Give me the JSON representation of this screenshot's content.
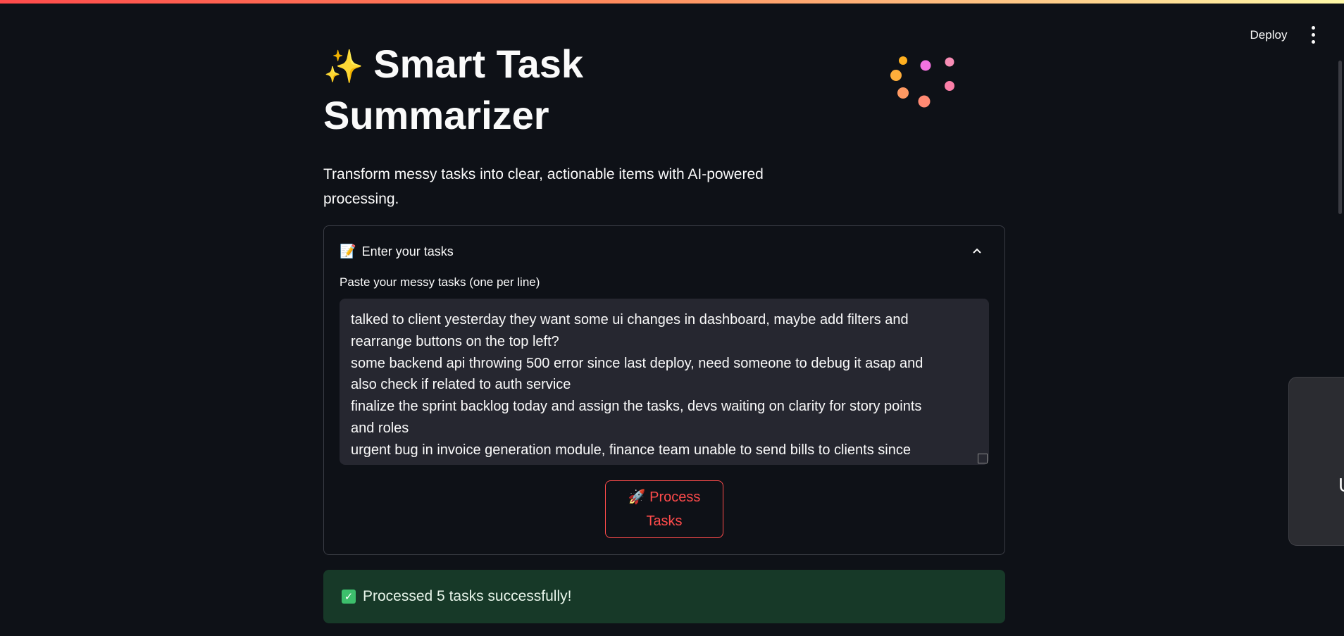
{
  "header": {
    "deploy_label": "Deploy",
    "menu_icon": "vertical-ellipsis-icon"
  },
  "app": {
    "title_emoji": "✨",
    "title_line1": "Smart Task",
    "title_line2": "Summarizer",
    "subtitle": "Transform messy tasks into clear, actionable items with AI-powered processing."
  },
  "expander": {
    "icon": "📝",
    "label": "Enter your tasks",
    "chevron_icon": "chevron-up-icon",
    "textarea_label": "Paste your messy tasks (one per line)",
    "textarea_value": "talked to client yesterday they want some ui changes in dashboard, maybe add filters and rearrange buttons on the top left?\nsome backend api throwing 500 error since last deploy, need someone to debug it asap and also check if related to auth service\nfinalize the sprint backlog today and assign the tasks, devs waiting on clarity for story points and roles\nurgent bug in invoice generation module, finance team unable to send bills to clients since",
    "button_icon": "🚀",
    "button_label_line1": "Process",
    "button_label_line2": "Tasks"
  },
  "status": {
    "icon": "check-box-icon",
    "message": "Processed 5 tasks successfully!"
  },
  "side_toast": {
    "text": "U"
  },
  "colors": {
    "background": "#0e1117",
    "accent": "#ff4b4b",
    "success_bg": "#173928",
    "input_bg": "#262730"
  }
}
